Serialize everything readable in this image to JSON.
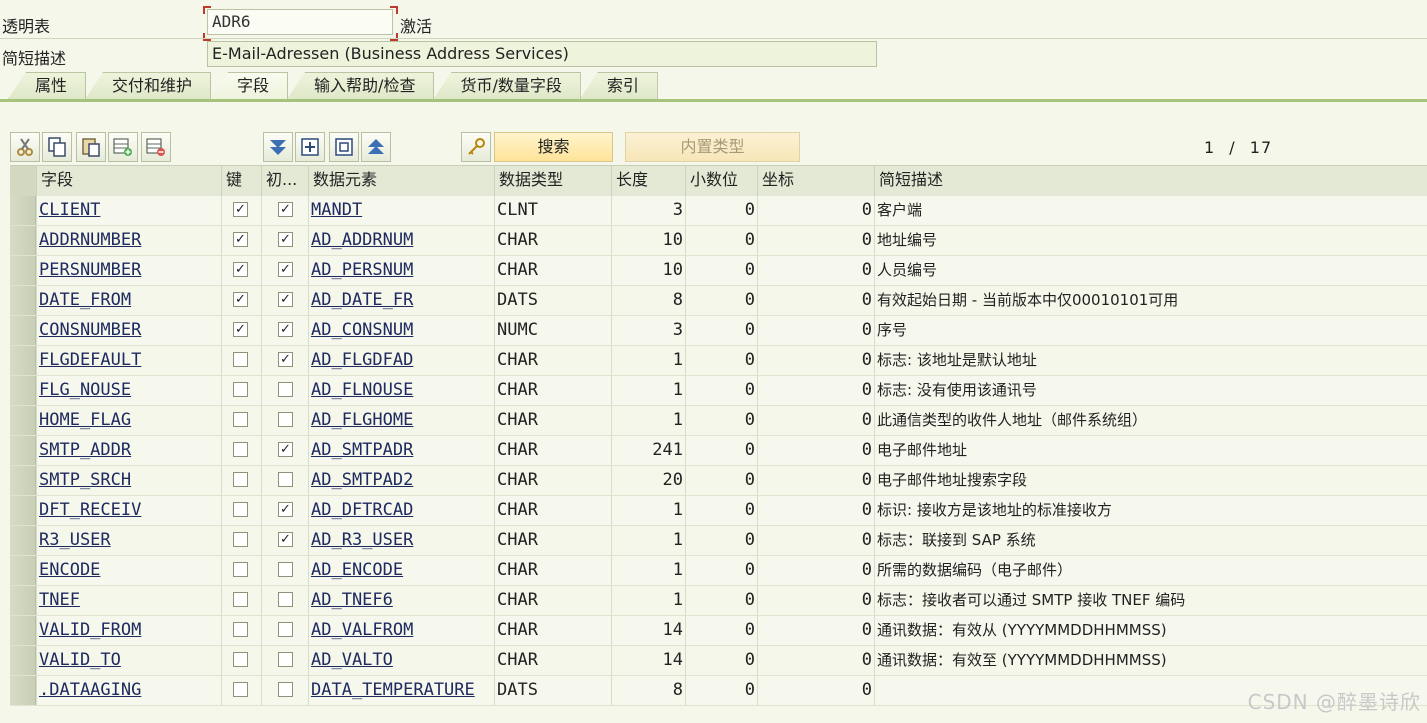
{
  "header": {
    "table_label": "透明表",
    "table_name": "ADR6",
    "status": "激活",
    "desc_label": "简短描述",
    "description": "E-Mail-Adressen (Business Address Services)"
  },
  "tabs": [
    {
      "label": "属性",
      "active": false
    },
    {
      "label": "交付和维护",
      "active": false
    },
    {
      "label": "字段",
      "active": true
    },
    {
      "label": "输入帮助/检查",
      "active": false
    },
    {
      "label": "货币/数量字段",
      "active": false
    },
    {
      "label": "索引",
      "active": false
    }
  ],
  "toolbar": {
    "icons": [
      "cut-icon",
      "copy-icon",
      "paste-icon",
      "insert-row-icon",
      "delete-row-icon",
      "expand-all-icon",
      "insert-icon",
      "collapse-icon",
      "collapse-all-icon",
      "key-icon"
    ],
    "search_label": "搜索",
    "builtin_type_label": "内置类型",
    "page_current": "1",
    "page_separator": "/",
    "page_total": "17"
  },
  "columns": {
    "field": "字段",
    "key": "键",
    "initial": "初...",
    "data_element": "数据元素",
    "data_type": "数据类型",
    "length": "长度",
    "decimals": "小数位",
    "coordinate": "坐标",
    "short_desc": "简短描述"
  },
  "rows": [
    {
      "field": "CLIENT",
      "key": true,
      "initial": true,
      "element": "MANDT",
      "type": "CLNT",
      "length": "3",
      "decimals": "0",
      "coord": "0",
      "desc": "客户端"
    },
    {
      "field": "ADDRNUMBER",
      "key": true,
      "initial": true,
      "element": "AD_ADDRNUM",
      "type": "CHAR",
      "length": "10",
      "decimals": "0",
      "coord": "0",
      "desc": "地址编号"
    },
    {
      "field": "PERSNUMBER",
      "key": true,
      "initial": true,
      "element": "AD_PERSNUM",
      "type": "CHAR",
      "length": "10",
      "decimals": "0",
      "coord": "0",
      "desc": "人员编号"
    },
    {
      "field": "DATE_FROM",
      "key": true,
      "initial": true,
      "element": "AD_DATE_FR",
      "type": "DATS",
      "length": "8",
      "decimals": "0",
      "coord": "0",
      "desc": "有效起始日期 - 当前版本中仅00010101可用"
    },
    {
      "field": "CONSNUMBER",
      "key": true,
      "initial": true,
      "element": "AD_CONSNUM",
      "type": "NUMC",
      "length": "3",
      "decimals": "0",
      "coord": "0",
      "desc": "序号"
    },
    {
      "field": "FLGDEFAULT",
      "key": false,
      "initial": true,
      "element": "AD_FLGDFAD",
      "type": "CHAR",
      "length": "1",
      "decimals": "0",
      "coord": "0",
      "desc": "标志: 该地址是默认地址"
    },
    {
      "field": "FLG_NOUSE",
      "key": false,
      "initial": false,
      "element": "AD_FLNOUSE",
      "type": "CHAR",
      "length": "1",
      "decimals": "0",
      "coord": "0",
      "desc": "标志: 没有使用该通讯号"
    },
    {
      "field": "HOME_FLAG",
      "key": false,
      "initial": false,
      "element": "AD_FLGHOME",
      "type": "CHAR",
      "length": "1",
      "decimals": "0",
      "coord": "0",
      "desc": "此通信类型的收件人地址（邮件系统组）"
    },
    {
      "field": "SMTP_ADDR",
      "key": false,
      "initial": true,
      "element": "AD_SMTPADR",
      "type": "CHAR",
      "length": "241",
      "decimals": "0",
      "coord": "0",
      "desc": "电子邮件地址"
    },
    {
      "field": "SMTP_SRCH",
      "key": false,
      "initial": false,
      "element": "AD_SMTPAD2",
      "type": "CHAR",
      "length": "20",
      "decimals": "0",
      "coord": "0",
      "desc": "电子邮件地址搜索字段"
    },
    {
      "field": "DFT_RECEIV",
      "key": false,
      "initial": true,
      "element": "AD_DFTRCAD",
      "type": "CHAR",
      "length": "1",
      "decimals": "0",
      "coord": "0",
      "desc": "标识: 接收方是该地址的标准接收方"
    },
    {
      "field": "R3_USER",
      "key": false,
      "initial": true,
      "element": "AD_R3_USER",
      "type": "CHAR",
      "length": "1",
      "decimals": "0",
      "coord": "0",
      "desc": "标志：联接到 SAP 系统"
    },
    {
      "field": "ENCODE",
      "key": false,
      "initial": false,
      "element": "AD_ENCODE",
      "type": "CHAR",
      "length": "1",
      "decimals": "0",
      "coord": "0",
      "desc": "所需的数据编码（电子邮件）"
    },
    {
      "field": "TNEF",
      "key": false,
      "initial": false,
      "element": "AD_TNEF6",
      "type": "CHAR",
      "length": "1",
      "decimals": "0",
      "coord": "0",
      "desc": "标志：接收者可以通过 SMTP 接收 TNEF 编码"
    },
    {
      "field": "VALID_FROM",
      "key": false,
      "initial": false,
      "element": "AD_VALFROM",
      "type": "CHAR",
      "length": "14",
      "decimals": "0",
      "coord": "0",
      "desc": "通讯数据：有效从 (YYYYMMDDHHMMSS)"
    },
    {
      "field": "VALID_TO",
      "key": false,
      "initial": false,
      "element": "AD_VALTO",
      "type": "CHAR",
      "length": "14",
      "decimals": "0",
      "coord": "0",
      "desc": "通讯数据：有效至 (YYYYMMDDHHMMSS)"
    },
    {
      "field": ".DATAAGING",
      "key": false,
      "initial": false,
      "element": "DATA_TEMPERATURE",
      "type": "DATS",
      "length": "8",
      "decimals": "0",
      "coord": "0",
      "desc": ""
    }
  ],
  "watermark": "CSDN @醉墨诗欣"
}
